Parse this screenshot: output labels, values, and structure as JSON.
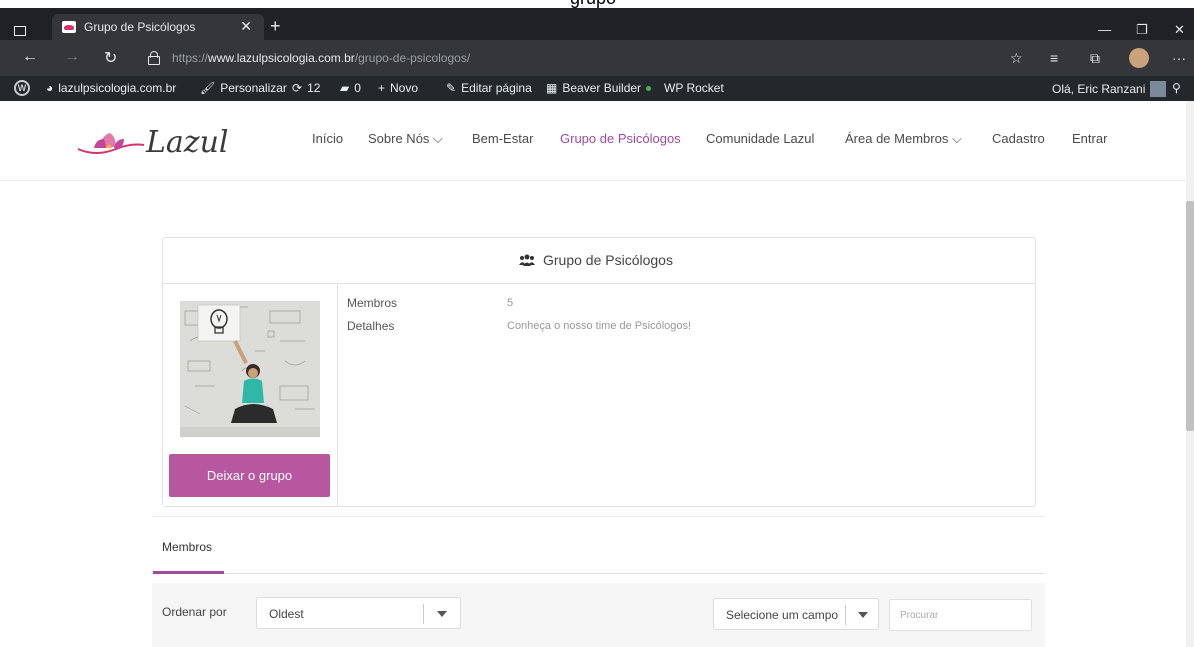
{
  "browser": {
    "tab_title": "Grupo de Psicólogos",
    "url_prefix": "https://",
    "url_domain": "www.lazulpsicologia.com.br",
    "url_path": "/grupo-de-psicologos/"
  },
  "caption": "grupo",
  "wp_admin_bar": {
    "site_name": "lazulpsicologia.com.br",
    "customize": "Personalizar",
    "updates_count": "12",
    "comments_count": "0",
    "new": "Novo",
    "edit_page": "Editar página",
    "beaver_builder": "Beaver Builder",
    "wp_rocket": "WP Rocket",
    "greeting": "Olá, Eric Ranzani"
  },
  "site": {
    "logo_text": "Lazul",
    "menu": [
      "Início",
      "Sobre Nós",
      "Bem-Estar",
      "Grupo de Psicólogos",
      "Comunidade Lazul",
      "Área de Membros",
      "Cadastro",
      "Entrar"
    ],
    "active_menu": "Grupo de Psicólogos"
  },
  "group": {
    "title": "Grupo de Psicólogos",
    "members_label": "Membros",
    "members_value": "5",
    "details_label": "Detalhes",
    "details_value": "Conheça o nosso time de Psicólogos!",
    "leave_button": "Deixar o grupo"
  },
  "tabs": {
    "members": "Membros"
  },
  "filters": {
    "order_label": "Ordenar por",
    "order_value": "Oldest",
    "field_select": "Selecione um campo",
    "search_placeholder": "Procurar"
  },
  "colors": {
    "accent": "#a04a9d",
    "button": "#b6579f",
    "wp_bar": "#23282d"
  }
}
